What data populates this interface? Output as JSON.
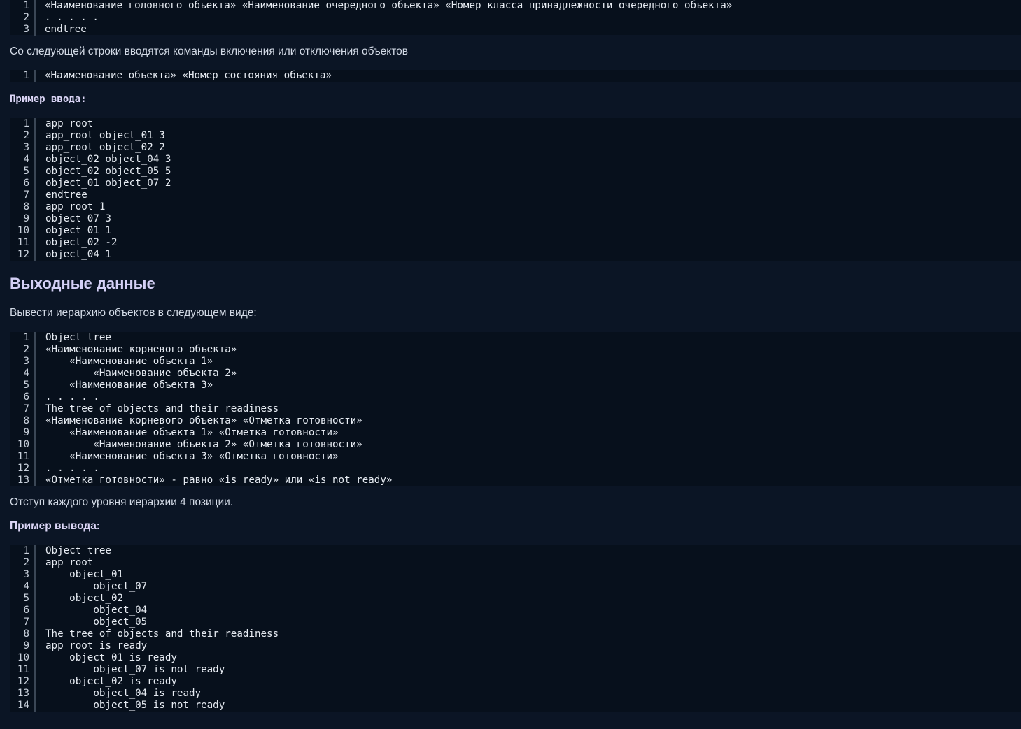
{
  "block1": {
    "lines": [
      {
        "n": "1",
        "t": "«Наименование головного объекта» «Наименование очередного объекта» «Номер класса принадлежности очередного объекта»"
      },
      {
        "n": "2",
        "t": ". . . . ."
      },
      {
        "n": "3",
        "t": "endtree"
      }
    ]
  },
  "para1": "Со следующей строки вводятся команды включения или отключения объектов",
  "block2": {
    "lines": [
      {
        "n": "1",
        "t": "«Наименование объекта» «Номер состояния объекта»"
      }
    ]
  },
  "input_example_label": "Пример ввода:",
  "block3": {
    "lines": [
      {
        "n": "1",
        "t": "app_root"
      },
      {
        "n": "2",
        "t": "app_root object_01 3"
      },
      {
        "n": "3",
        "t": "app_root object_02 2"
      },
      {
        "n": "4",
        "t": "object_02 object_04 3"
      },
      {
        "n": "5",
        "t": "object_02 object_05 5"
      },
      {
        "n": "6",
        "t": "object_01 object_07 2"
      },
      {
        "n": "7",
        "t": "endtree"
      },
      {
        "n": "8",
        "t": "app_root 1"
      },
      {
        "n": "9",
        "t": "object_07 3"
      },
      {
        "n": "10",
        "t": "object_01 1"
      },
      {
        "n": "11",
        "t": "object_02 -2"
      },
      {
        "n": "12",
        "t": "object_04 1"
      }
    ]
  },
  "output_heading": "Выходные данные",
  "para2": "Вывести иерархию объектов в следующем виде:",
  "block4": {
    "lines": [
      {
        "n": "1",
        "t": "Object tree"
      },
      {
        "n": "2",
        "t": "«Наименование корневого объекта»"
      },
      {
        "n": "3",
        "t": "    «Наименование объекта 1»"
      },
      {
        "n": "4",
        "t": "        «Наименование объекта 2»"
      },
      {
        "n": "5",
        "t": "    «Наименование объекта 3»"
      },
      {
        "n": "6",
        "t": ". . . . ."
      },
      {
        "n": "7",
        "t": "The tree of objects and their readiness"
      },
      {
        "n": "8",
        "t": "«Наименование корневого объекта» «Отметка готовности»"
      },
      {
        "n": "9",
        "t": "    «Наименование объекта 1» «Отметка готовности»"
      },
      {
        "n": "10",
        "t": "        «Наименование объекта 2» «Отметка готовности»"
      },
      {
        "n": "11",
        "t": "    «Наименование объекта 3» «Отметка готовности»"
      },
      {
        "n": "12",
        "t": ". . . . ."
      },
      {
        "n": "13",
        "t": "«Отметка готовности» - равно «is ready» или «is not ready»"
      }
    ]
  },
  "para3": "Отступ каждого уровня иерархии 4 позиции.",
  "output_example_label": "Пример вывода:",
  "block5": {
    "lines": [
      {
        "n": "1",
        "t": "Object tree"
      },
      {
        "n": "2",
        "t": "app_root"
      },
      {
        "n": "3",
        "t": "    object_01"
      },
      {
        "n": "4",
        "t": "        object_07"
      },
      {
        "n": "5",
        "t": "    object_02"
      },
      {
        "n": "6",
        "t": "        object_04"
      },
      {
        "n": "7",
        "t": "        object_05"
      },
      {
        "n": "8",
        "t": "The tree of objects and their readiness"
      },
      {
        "n": "9",
        "t": "app_root is ready"
      },
      {
        "n": "10",
        "t": "    object_01 is ready"
      },
      {
        "n": "11",
        "t": "        object_07 is not ready"
      },
      {
        "n": "12",
        "t": "    object_02 is ready"
      },
      {
        "n": "13",
        "t": "        object_04 is ready"
      },
      {
        "n": "14",
        "t": "        object_05 is not ready"
      }
    ]
  }
}
